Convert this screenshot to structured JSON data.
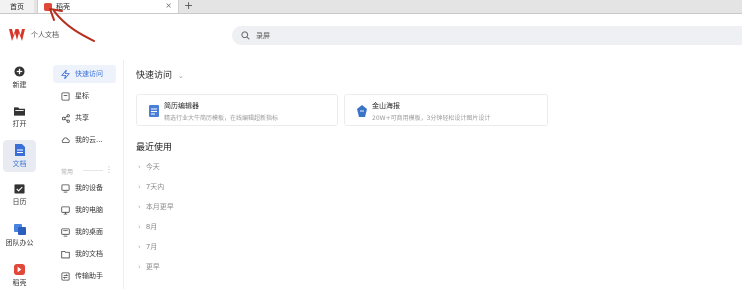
{
  "tabs": {
    "home": "首页",
    "active": "稻壳",
    "add": "+"
  },
  "header": {
    "title": "个人文档",
    "search_placeholder": "录屏"
  },
  "rail": [
    {
      "label": "新建",
      "icon": "plus-circle-icon"
    },
    {
      "label": "打开",
      "icon": "folder-icon"
    },
    {
      "label": "文档",
      "icon": "document-icon"
    },
    {
      "label": "日历",
      "icon": "calendar-icon"
    },
    {
      "label": "团队办公",
      "icon": "team-icon"
    },
    {
      "label": "稻壳",
      "icon": "docer-icon"
    }
  ],
  "sidebar": {
    "items": [
      {
        "label": "快速访问",
        "icon": "lightning-icon"
      },
      {
        "label": "星标",
        "icon": "star-icon"
      },
      {
        "label": "共享",
        "icon": "share-icon"
      },
      {
        "label": "我的云...",
        "icon": "cloud-icon"
      }
    ],
    "section_label": "常用",
    "section_items": [
      {
        "label": "我的设备",
        "icon": "device-icon"
      },
      {
        "label": "我的电脑",
        "icon": "computer-icon"
      },
      {
        "label": "我的桌面",
        "icon": "desktop-icon"
      },
      {
        "label": "我的文档",
        "icon": "folder-doc-icon"
      },
      {
        "label": "传输助手",
        "icon": "transfer-icon"
      }
    ]
  },
  "main": {
    "quick_title": "快速访问",
    "cards": [
      {
        "title": "简历编辑器",
        "subtitle": "精选行业大牛简历模板，在线编辑超新指标"
      },
      {
        "title": "金山海报",
        "subtitle": "20W+可商用模板，3分钟轻松设计图片设计"
      }
    ],
    "recent_title": "最近使用",
    "recent_groups": [
      "今天",
      "7天内",
      "本月更早",
      "8月",
      "7月",
      "更早"
    ]
  },
  "colors": {
    "accent": "#3a6fd8",
    "brand_red": "#d8362a"
  }
}
